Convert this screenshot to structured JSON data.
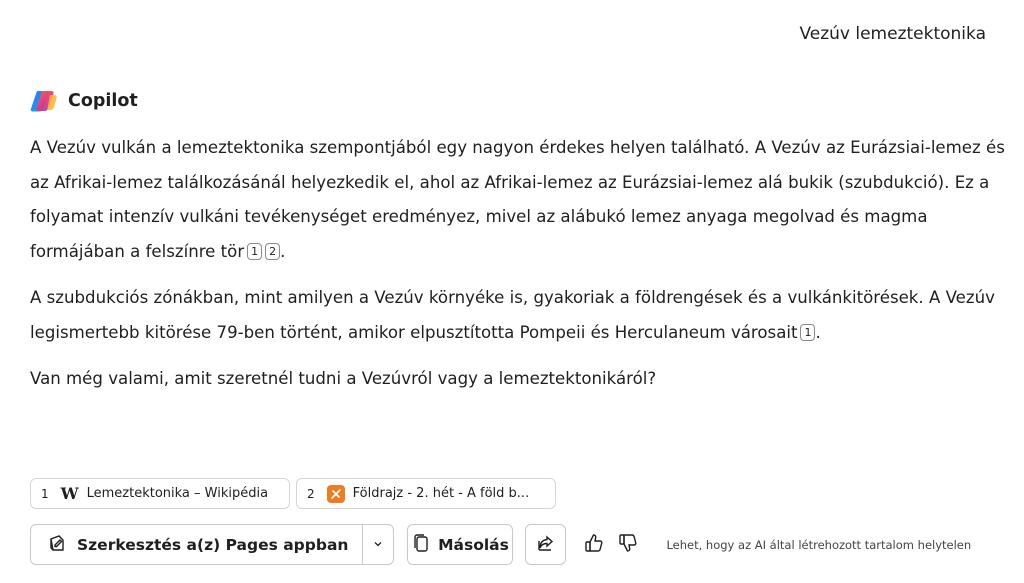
{
  "conversation": {
    "user_message": "Vezúv lemeztektonika"
  },
  "copilot": {
    "name": "Copilot",
    "paragraphs": [
      {
        "text": "A Vezúv vulkán a lemeztektonika szempontjából egy nagyon érdekes helyen található. A Vezúv az Eurázsiai-lemez és az Afrikai-lemez találkozásánál helyezkedik el, ahol az Afrikai-lemez az Eurázsiai-lemez alá bukik (szubdukció). Ez a folyamat intenzív vulkáni tevékenységet eredményez, mivel az alábukó lemez anyaga megolvad és magma formájában a felszínre tör",
        "citations": [
          "1",
          "2"
        ],
        "end": "."
      },
      {
        "text": "A szubdukciós zónákban, mint amilyen a Vezúv környéke is, gyakoriak a földrengések és a vulkánkitörések. A Vezúv legismertebb kitörése 79-ben történt, amikor elpusztította Pompeii és Herculaneum városait",
        "citations": [
          "1"
        ],
        "end": "."
      },
      {
        "text": "Van még valami, amit szeretnél tudni a Vezúvról vagy a lemeztektonikáról?",
        "citations": [],
        "end": ""
      }
    ]
  },
  "sources": [
    {
      "num": "1",
      "icon": "wikipedia-icon",
      "label": "Lemeztektonika – Wikipédia"
    },
    {
      "num": "2",
      "icon": "site-favicon",
      "label": "Földrajz - 2. hét - A föld b..."
    }
  ],
  "actions": {
    "edit_label": "Szerkesztés a(z) Pages appban",
    "copy_label": "Másolás",
    "disclaimer": "Lehet, hogy az AI által létrehozott tartalom helytelen"
  },
  "colors": {
    "text": "#1f1f1f",
    "border": "#c8c8c8",
    "favicon_orange": "#f07b22"
  }
}
